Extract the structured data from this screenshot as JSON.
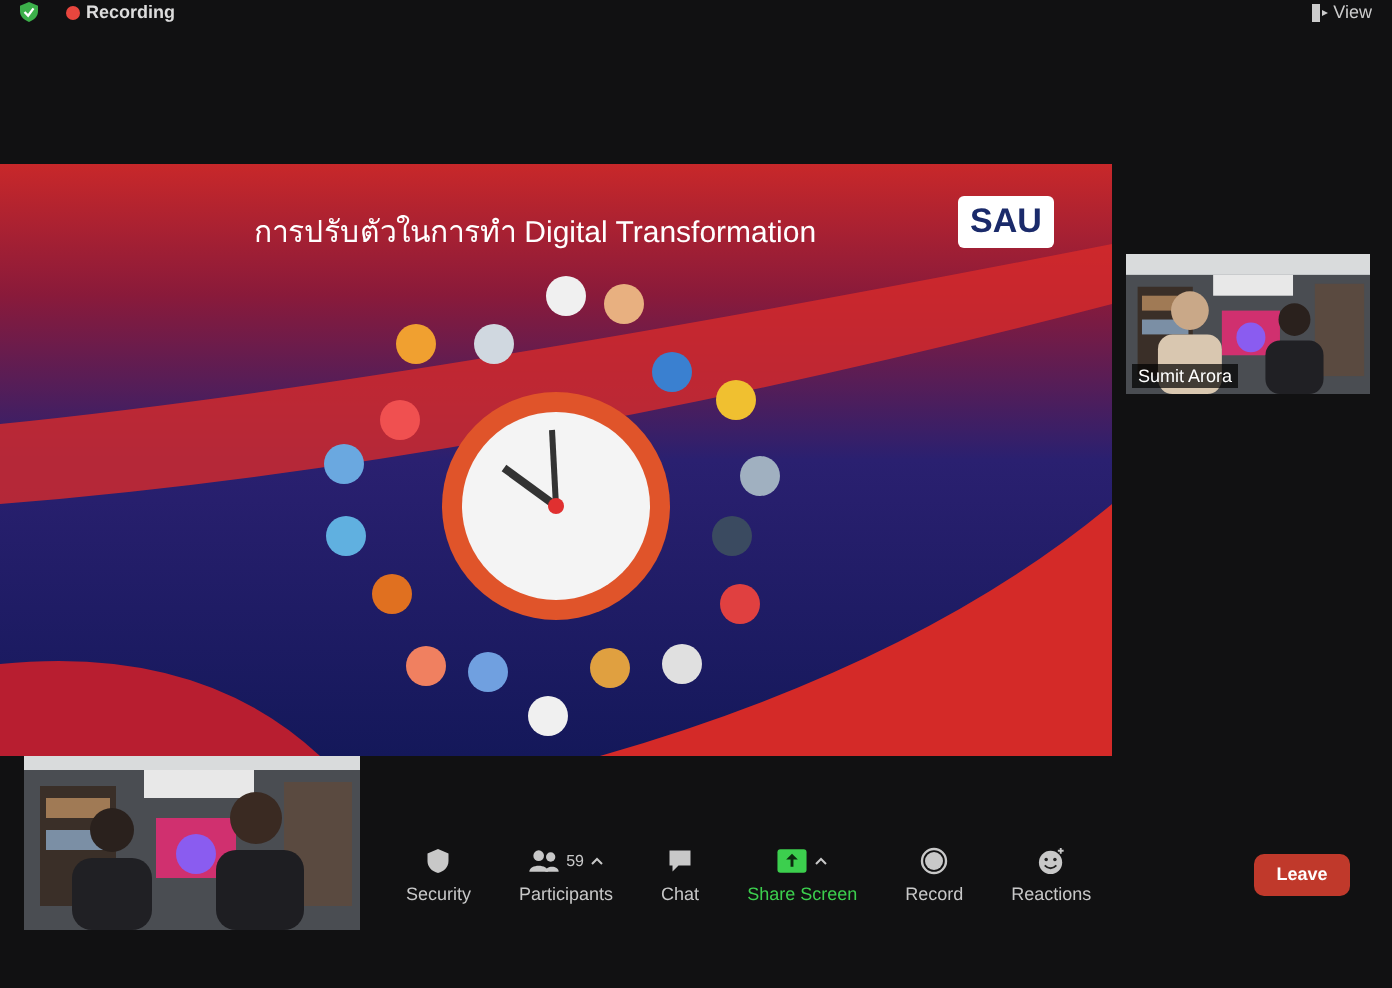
{
  "top_bar": {
    "recording": {
      "label": "Recording"
    },
    "view": {
      "label": "View"
    }
  },
  "shared_slide": {
    "title": "การปรับตัวในการทำ Digital Transformation",
    "logo": "SAU"
  },
  "participant_videos": [
    {
      "name": "Sumit Arora"
    }
  ],
  "toolbar": [
    {
      "kind": "security",
      "label": "Security",
      "caret": false,
      "color": "#c8c8c8"
    },
    {
      "kind": "participants",
      "label": "Participants",
      "count": "59",
      "caret": true,
      "color": "#c8c8c8"
    },
    {
      "kind": "chat",
      "label": "Chat",
      "caret": false,
      "color": "#c8c8c8"
    },
    {
      "kind": "share",
      "label": "Share Screen",
      "caret": true,
      "color": "#3ccf4e"
    },
    {
      "kind": "record",
      "label": "Record",
      "caret": false,
      "color": "#c8c8c8"
    },
    {
      "kind": "reactions",
      "label": "Reactions",
      "caret": false,
      "color": "#c8c8c8"
    }
  ],
  "leave_button": {
    "label": "Leave"
  }
}
